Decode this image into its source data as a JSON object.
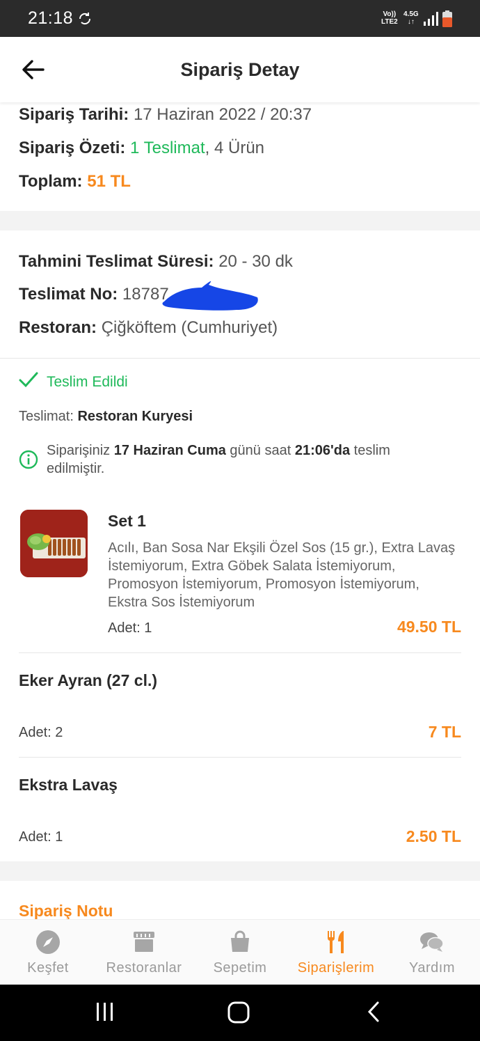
{
  "status": {
    "time": "21:18",
    "net_top": "Vo))",
    "net_bottom": "LTE2",
    "net2_top": "4.5G",
    "net2_bottom": "↓↑"
  },
  "header": {
    "title": "Sipariş Detay"
  },
  "summary": {
    "date_label": "Sipariş Tarihi:",
    "date_value": "17 Haziran 2022 / 20:37",
    "overview_label": "Sipariş Özeti:",
    "overview_deliveries": "1 Teslimat",
    "overview_products": ", 4 Ürün",
    "total_label": "Toplam:",
    "total_value": "51 TL"
  },
  "delivery": {
    "eta_label": "Tahmini Teslimat Süresi:",
    "eta_value": "20 - 30 dk",
    "no_label": "Teslimat No:",
    "no_value": "18787",
    "restaurant_label": "Restoran:",
    "restaurant_value": "Çiğköftem (Cumhuriyet)"
  },
  "status_block": {
    "state": "Teslim Edildi",
    "method_label": "Teslimat:",
    "method_value": "Restoran Kuryesi",
    "info_pre": "Siparişiniz ",
    "info_date": "17 Haziran Cuma",
    "info_mid": " günü saat ",
    "info_time": "21:06'da",
    "info_post": " teslim edilmiştir."
  },
  "items": [
    {
      "name": "Set 1",
      "description": "Acılı, Ban Sosa Nar Ekşili Özel Sos (15 gr.), Extra Lavaş İstemiyorum, Extra Göbek Salata İstemiyorum, Promosyon İstemiyorum, Promosyon İstemiyorum, Ekstra Sos İstemiyorum",
      "qty": "Adet: 1",
      "price": "49.50 TL"
    },
    {
      "name": "Eker Ayran (27 cl.)",
      "qty": "Adet: 2",
      "price": "7 TL"
    },
    {
      "name": "Ekstra Lavaş",
      "qty": "Adet: 1",
      "price": "2.50 TL"
    }
  ],
  "note": {
    "title": "Sipariş Notu"
  },
  "nav": [
    {
      "label": "Keşfet",
      "icon": "compass-icon"
    },
    {
      "label": "Restoranlar",
      "icon": "store-icon"
    },
    {
      "label": "Sepetim",
      "icon": "bag-icon"
    },
    {
      "label": "Siparişlerim",
      "icon": "fork-knife-icon",
      "active": true
    },
    {
      "label": "Yardım",
      "icon": "chat-icon"
    }
  ],
  "colors": {
    "accent": "#f7891e",
    "success": "#1fb95a",
    "nav_inactive": "#9a9a9a",
    "redaction": "#1646e6"
  }
}
